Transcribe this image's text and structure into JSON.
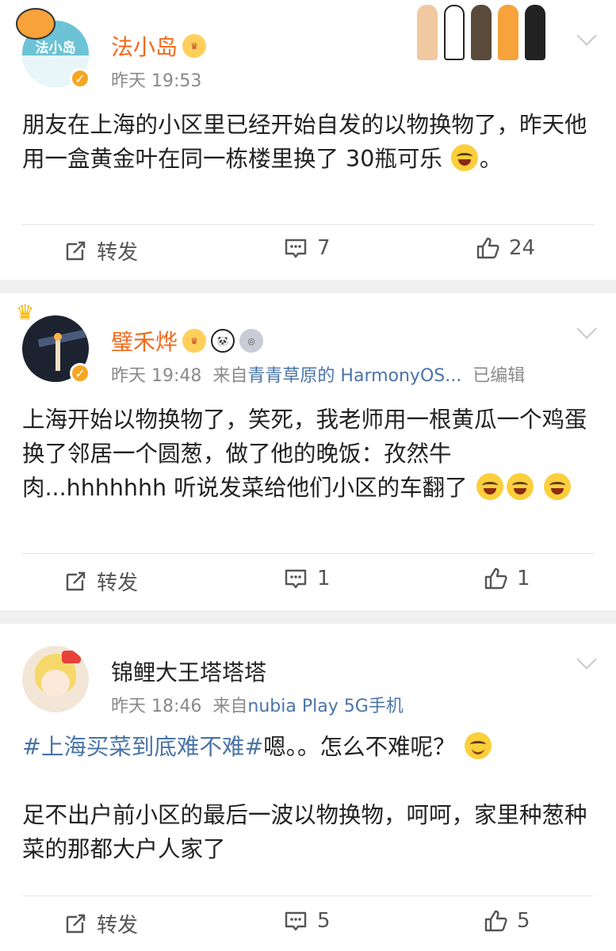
{
  "posts": [
    {
      "name": "法小岛",
      "time": "昨天 19:53",
      "source_prefix": "",
      "source": "",
      "edited": "",
      "avatar_text": "法小岛",
      "text": "朋友在上海的小区里已经开始自发的以物换物了，昨天他用一盒黄金叶在同一栋楼里换了 30瓶可乐",
      "text_tail": "。",
      "repost_label": "转发",
      "comments": "7",
      "likes": "24"
    },
    {
      "name": "璧禾烨",
      "time": "昨天 19:48",
      "source_prefix": "来自",
      "source": "青青草原的 HarmonyOS...",
      "edited": "已编辑",
      "text": "上海开始以物换物了，笑死，我老师用一根黄瓜一个鸡蛋换了邻居一个圆葱，做了他的晚饭：孜然牛肉...hhhhhhh 听说发菜给他们小区的车翻了",
      "repost_label": "转发",
      "comments": "1",
      "likes": "1"
    },
    {
      "name": "锦鲤大王塔塔塔",
      "time": "昨天 18:46",
      "source_prefix": "来自",
      "source": "nubia Play 5G手机",
      "topic": "#上海买菜到底难不难#",
      "text_after_topic": "嗯。。怎么不难呢？",
      "text2": "足不出户前小区的最后一波以物换物，呵呵，家里种葱种菜的那都大户人家了",
      "repost_label": "转发",
      "comments": "5",
      "likes": "5"
    }
  ],
  "colors": {
    "accent_orange": "#f26a1b",
    "link_blue": "#4a74a8",
    "meta_gray": "#8a8a8a"
  }
}
